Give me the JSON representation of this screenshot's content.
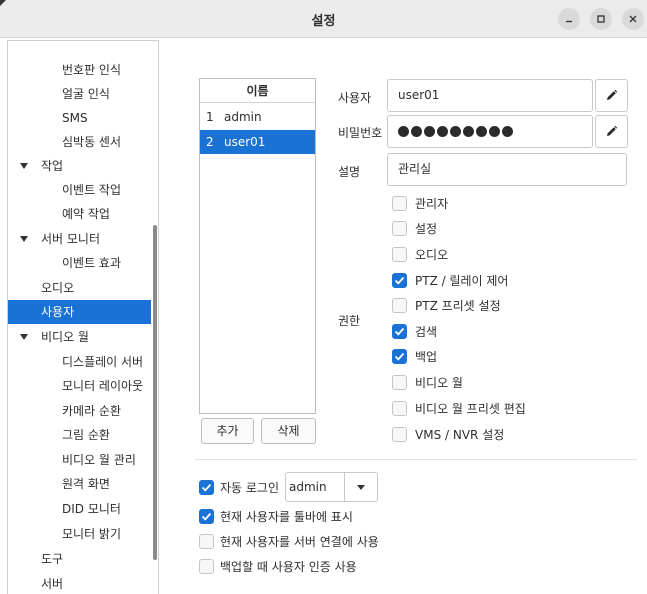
{
  "window": {
    "title": "설정"
  },
  "sidebar": {
    "items": [
      {
        "label": "번호판 인식"
      },
      {
        "label": "얼굴 인식"
      },
      {
        "label": "SMS"
      },
      {
        "label": "심박동 센서"
      },
      {
        "label": "작업"
      },
      {
        "label": "이벤트 작업"
      },
      {
        "label": "예약 작업"
      },
      {
        "label": "서버 모니터"
      },
      {
        "label": "이벤트 효과"
      },
      {
        "label": "오디오"
      },
      {
        "label": "사용자"
      },
      {
        "label": "비디오 월"
      },
      {
        "label": "디스플레이 서버"
      },
      {
        "label": "모니터 레이아웃"
      },
      {
        "label": "카메라 순환"
      },
      {
        "label": "그림 순환"
      },
      {
        "label": "비디오 월 관리"
      },
      {
        "label": "원격 화면"
      },
      {
        "label": "DID 모니터"
      },
      {
        "label": "모니터 밝기"
      },
      {
        "label": "도구"
      },
      {
        "label": "서버"
      }
    ]
  },
  "user_list": {
    "header": "이름",
    "rows": [
      {
        "num": "1",
        "name": "admin"
      },
      {
        "num": "2",
        "name": "user01"
      }
    ],
    "add_label": "추가",
    "delete_label": "삭제"
  },
  "form": {
    "user_label": "사용자",
    "user_value": "user01",
    "password_label": "비밀번호",
    "desc_label": "설명",
    "desc_value": "관리실",
    "permission_label": "권한"
  },
  "permissions": [
    {
      "label": "관리자",
      "checked": false
    },
    {
      "label": "설정",
      "checked": false
    },
    {
      "label": "오디오",
      "checked": false
    },
    {
      "label": "PTZ / 릴레이 제어",
      "checked": true
    },
    {
      "label": "PTZ 프리셋 설정",
      "checked": false
    },
    {
      "label": "검색",
      "checked": true
    },
    {
      "label": "백업",
      "checked": true
    },
    {
      "label": "비디오 월",
      "checked": false
    },
    {
      "label": "비디오 월 프리셋 편집",
      "checked": false
    },
    {
      "label": "VMS / NVR 설정",
      "checked": false
    }
  ],
  "options": {
    "auto_login_label": "자동 로그인",
    "auto_login_checked": true,
    "auto_login_value": "admin",
    "show_user_label": "현재 사용자를 툴바에 표시",
    "show_user_checked": true,
    "server_conn_label": "현재 사용자를 서버 연결에 사용",
    "server_conn_checked": false,
    "backup_auth_label": "백업할 때 사용자 인증 사용",
    "backup_auth_checked": false
  },
  "colors": {
    "accent": "#1a73d4"
  }
}
